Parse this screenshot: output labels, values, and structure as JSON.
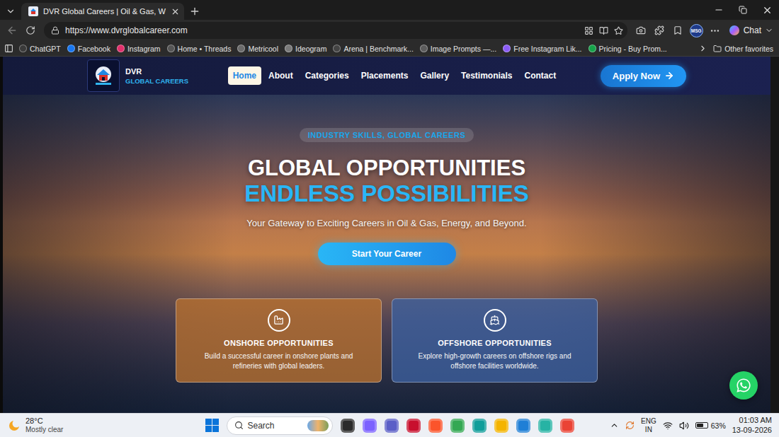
{
  "browser": {
    "tab": {
      "title": "DVR Global Careers | Oil & Gas, W",
      "selected": true
    },
    "url": "https://www.dvrglobalcareer.com",
    "profile": "MSG",
    "chat": "Chat",
    "bookmarks": [
      {
        "label": "ChatGPT",
        "color": "#3a3a3a"
      },
      {
        "label": "Facebook",
        "color": "#1877f2"
      },
      {
        "label": "Instagram",
        "color": "#e1306c"
      },
      {
        "label": "Home • Threads",
        "color": "#555555"
      },
      {
        "label": "Metricool",
        "color": "#6b6b6b"
      },
      {
        "label": "Ideogram",
        "color": "#7a7a7a"
      },
      {
        "label": "Arena | Benchmark...",
        "color": "#444444"
      },
      {
        "label": "Image Prompts —...",
        "color": "#5c5c5c"
      },
      {
        "label": "Free Instagram Lik...",
        "color": "#8b5cf6"
      },
      {
        "label": "Pricing - Buy Prom...",
        "color": "#16a34a"
      }
    ],
    "other_favorites": "Other favorites"
  },
  "site": {
    "logo": {
      "name": "DVR",
      "tagline": "GLOBAL CAREERS"
    },
    "nav": [
      {
        "label": "Home",
        "selected": true
      },
      {
        "label": "About",
        "selected": false
      },
      {
        "label": "Categories",
        "selected": false
      },
      {
        "label": "Placements",
        "selected": false
      },
      {
        "label": "Gallery",
        "selected": false
      },
      {
        "label": "Testimonials",
        "selected": false
      },
      {
        "label": "Contact",
        "selected": false
      }
    ],
    "apply": "Apply Now",
    "hero": {
      "badge": "INDUSTRY SKILLS, GLOBAL CAREERS",
      "title": "GLOBAL OPPORTUNITIES",
      "accent": "ENDLESS POSSIBILITIES",
      "subtitle": "Your Gateway to Exciting Careers in Oil & Gas, Energy, and Beyond.",
      "cta": "Start Your Career"
    },
    "cards": [
      {
        "kind": "onshore",
        "title": "ONSHORE OPPORTUNITIES",
        "text": "Build a successful career in onshore plants and refineries with global leaders.",
        "color": "#b8702f"
      },
      {
        "kind": "offshore",
        "title": "OFFSHORE OPPORTUNITIES",
        "text": "Explore high-growth careers on offshore rigs and offshore facilities worldwide.",
        "color": "#3c5f9e"
      }
    ]
  },
  "taskbar": {
    "weather": {
      "temp": "28°C",
      "condition": "Mostly clear"
    },
    "search": "Search",
    "apps": [
      {
        "color": "#2b2b2b"
      },
      {
        "color": "#7b61ff"
      },
      {
        "color": "#5b5fc7"
      },
      {
        "color": "#c8102e"
      },
      {
        "color": "#fb542b"
      },
      {
        "color": "#34a853"
      },
      {
        "color": "#0f9d9a"
      },
      {
        "color": "#f4b400"
      },
      {
        "color": "#1f7fd6"
      },
      {
        "color": "#27b3a4"
      },
      {
        "color": "#ea4335"
      }
    ],
    "language": "ENG",
    "region": "IN",
    "battery": "63%",
    "battery_level": 0.63,
    "time": "01:03 AM",
    "date": "13-09-2026"
  }
}
